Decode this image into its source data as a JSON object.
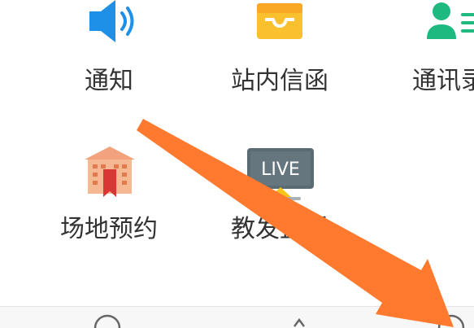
{
  "colors": {
    "notify_blue": "#1E90E8",
    "mail_yellow": "#FBC02D",
    "contact_green": "#1EB980",
    "venue_orange": "#F2A27C",
    "bookmark_red": "#D93636",
    "live_gray": "#5B6B73",
    "live_yellow": "#F5C518",
    "arrow_orange": "#FF7A2F"
  },
  "tiles": [
    {
      "label": "通知",
      "icon": "speaker-icon"
    },
    {
      "label": "站内信函",
      "icon": "inbox-tray-icon"
    },
    {
      "label": "通讯录",
      "icon": "contact-card-icon"
    },
    {
      "label": "场地预约",
      "icon": "building-bookmark-icon"
    },
    {
      "label": "教发直播",
      "icon": "live-screen-icon"
    }
  ],
  "live_badge": "LIVE"
}
